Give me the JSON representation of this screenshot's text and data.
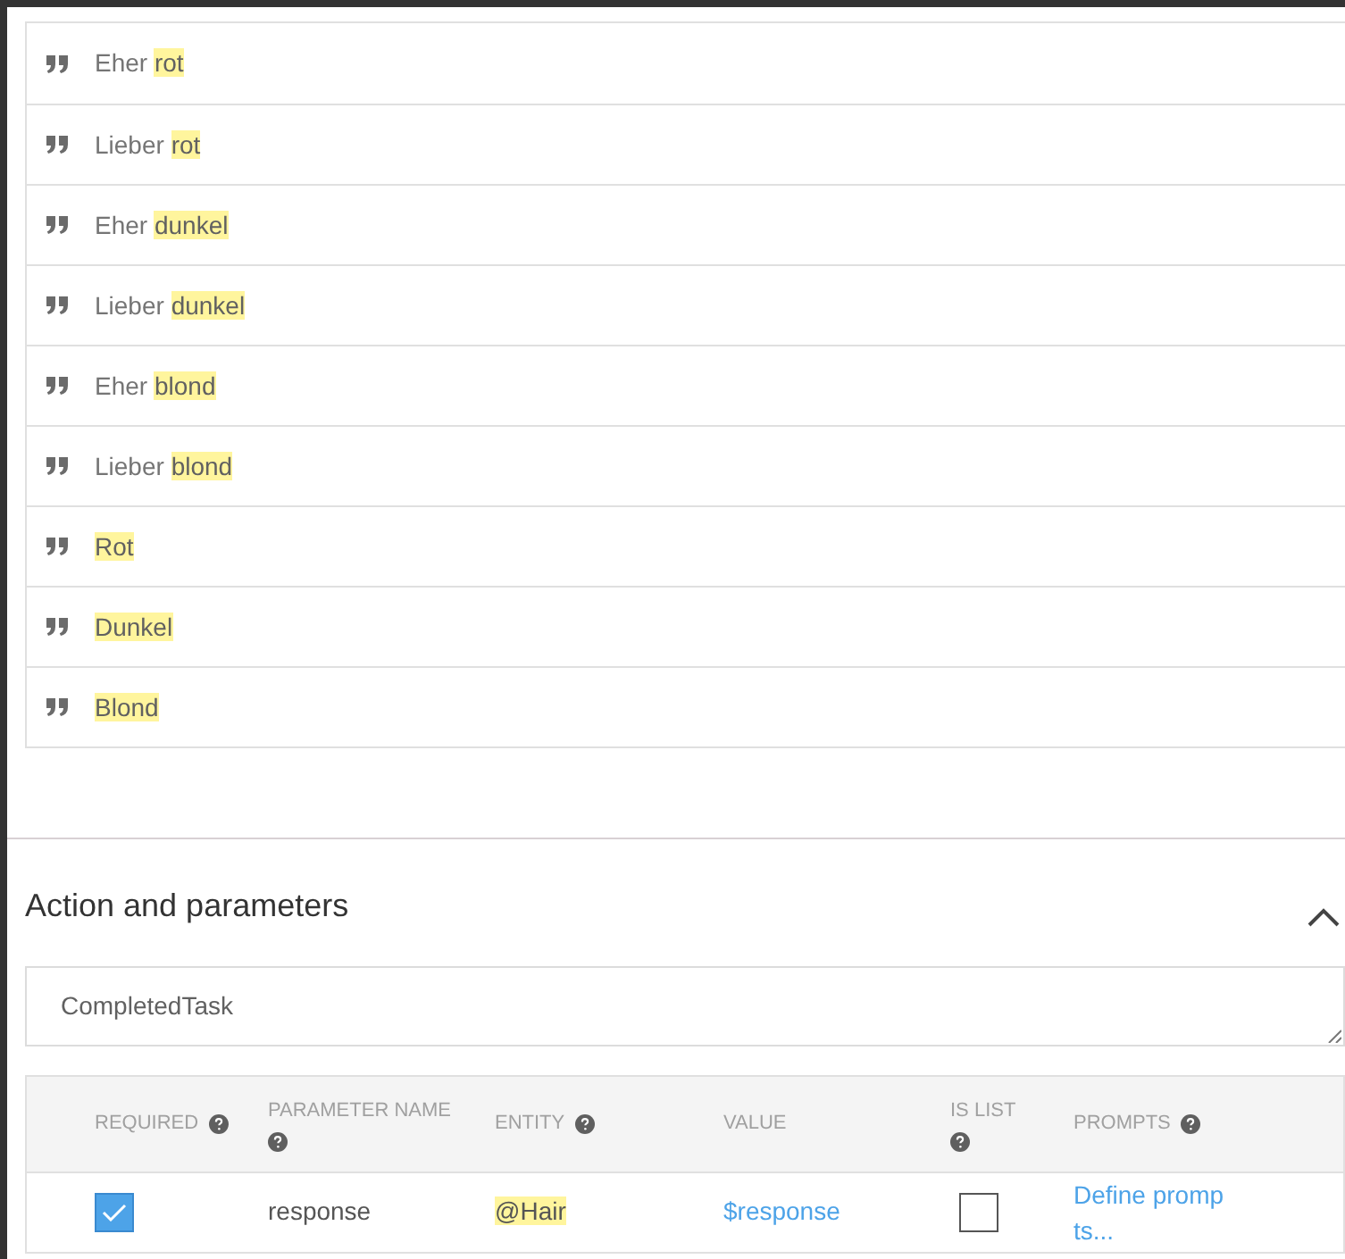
{
  "phrases": [
    {
      "parts": [
        {
          "text": "Eher ",
          "highlighted": false
        },
        {
          "text": "rot",
          "highlighted": true
        }
      ]
    },
    {
      "parts": [
        {
          "text": "Lieber ",
          "highlighted": false
        },
        {
          "text": "rot",
          "highlighted": true
        }
      ]
    },
    {
      "parts": [
        {
          "text": "Eher ",
          "highlighted": false
        },
        {
          "text": "dunkel",
          "highlighted": true
        }
      ]
    },
    {
      "parts": [
        {
          "text": "Lieber ",
          "highlighted": false
        },
        {
          "text": "dunkel",
          "highlighted": true
        }
      ]
    },
    {
      "parts": [
        {
          "text": "Eher ",
          "highlighted": false
        },
        {
          "text": "blond",
          "highlighted": true
        }
      ]
    },
    {
      "parts": [
        {
          "text": "Lieber ",
          "highlighted": false
        },
        {
          "text": "blond",
          "highlighted": true
        }
      ]
    },
    {
      "parts": [
        {
          "text": "Rot",
          "highlighted": true
        }
      ]
    },
    {
      "parts": [
        {
          "text": "Dunkel",
          "highlighted": true
        }
      ]
    },
    {
      "parts": [
        {
          "text": "Blond",
          "highlighted": true
        }
      ]
    }
  ],
  "section": {
    "title": "Action and parameters",
    "expanded": true
  },
  "action_field": {
    "value": "CompletedTask"
  },
  "table": {
    "columns": [
      {
        "label": "REQUIRED",
        "help": true
      },
      {
        "label": "PARAMETER NAME",
        "help": true
      },
      {
        "label": "ENTITY",
        "help": true
      },
      {
        "label": "VALUE",
        "help": false
      },
      {
        "label": "IS LIST",
        "help": true
      },
      {
        "label": "PROMPTS",
        "help": true
      }
    ],
    "rows": [
      {
        "required": true,
        "name": "response",
        "entity": "@Hair",
        "entity_highlighted": true,
        "value": "$response",
        "is_list": false,
        "prompts": "Define promp ts..."
      }
    ]
  }
}
